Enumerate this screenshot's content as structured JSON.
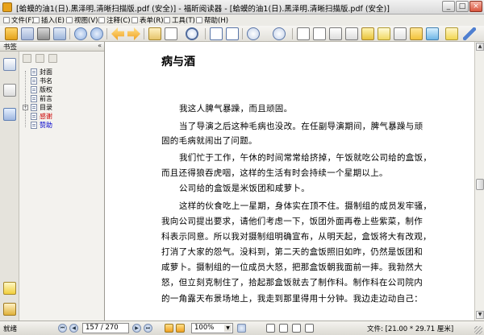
{
  "window": {
    "title": "[蛤蟆的油1(日).黑泽明.清晰扫描版.pdf (安全)] - 福昕阅读器 - [蛤蟆的油1(日).黑泽明.清晰扫描版.pdf (安全)]",
    "minimize": "_",
    "maximize": "□",
    "close": "×"
  },
  "menu": {
    "items": [
      "文件(F)",
      "插入(E)",
      "视图(V)",
      "注释(C)",
      "表单(R)",
      "工具(T)",
      "帮助(H)"
    ]
  },
  "sidebar": {
    "header": "书签",
    "collapse": "«",
    "bookmarks": [
      {
        "label": "封面",
        "expandable": false,
        "color": "#000000"
      },
      {
        "label": "书名",
        "expandable": false,
        "color": "#000000"
      },
      {
        "label": "版权",
        "expandable": false,
        "color": "#000000"
      },
      {
        "label": "前言",
        "expandable": false,
        "color": "#000000"
      },
      {
        "label": "目录",
        "expandable": true,
        "color": "#000000"
      },
      {
        "label": "感谢",
        "expandable": false,
        "color": "#cc0000"
      },
      {
        "label": "赞助",
        "expandable": false,
        "color": "#0000cc"
      }
    ]
  },
  "document": {
    "title": "病与酒",
    "lines": [
      "我这人脾气暴躁，而且顽固。",
      "当了导演之后这种毛病也没改。在任副导演期间，脾气暴躁与顽",
      "固的毛病就闹出了问题。",
      "我们忙于工作，午休的时间常常给挤掉，午饭就吃公司给的盒饭，",
      "而且还得狼吞虎咽，这样的生活有时会持续一个星期以上。",
      "公司给的盒饭是米饭团和咸萝卜。",
      "这样的伙食吃上一星期，身体实在顶不住。摄制组的成员发牢骚，",
      "我向公司提出要求，请他们考虑一下，饭团外面再卷上些紫菜，制作",
      "科表示同意。所以我对摄制组明确宣布，从明天起，盒饭将大有改观，",
      "打消了大家的怨气。没料到，第二天的盒饭照旧如昨，仍然是饭团和",
      "咸萝卜。摄制组的一位成员大怒，把那盒饭朝我面前一摔。我勃然大",
      "怒，但立刻克制住了，拾起那盒饭就去了制作科。制作科在公司院内",
      "的一角露天布景场地上，我走到那里得用十分钟。我边走边动自己："
    ]
  },
  "status": {
    "left": "就绪",
    "page_display": "157 / 270",
    "zoom": "100%",
    "file_info": "文件: [21.00 * 29.71 厘米]",
    "first_page": "⏮",
    "prev_page": "◀",
    "next_page": "▶",
    "last_page": "⏭"
  },
  "icons": {
    "tree_expand": "+",
    "dropdown": "▼",
    "scroll_up": "▲",
    "scroll_down": "▼"
  },
  "colors": {
    "toolbar_bg": "#e9e7e0",
    "sidebar_bg": "#f3f2ee",
    "page_bg": "#ffffff",
    "link_red": "#cc0000",
    "link_blue": "#0000cc"
  }
}
